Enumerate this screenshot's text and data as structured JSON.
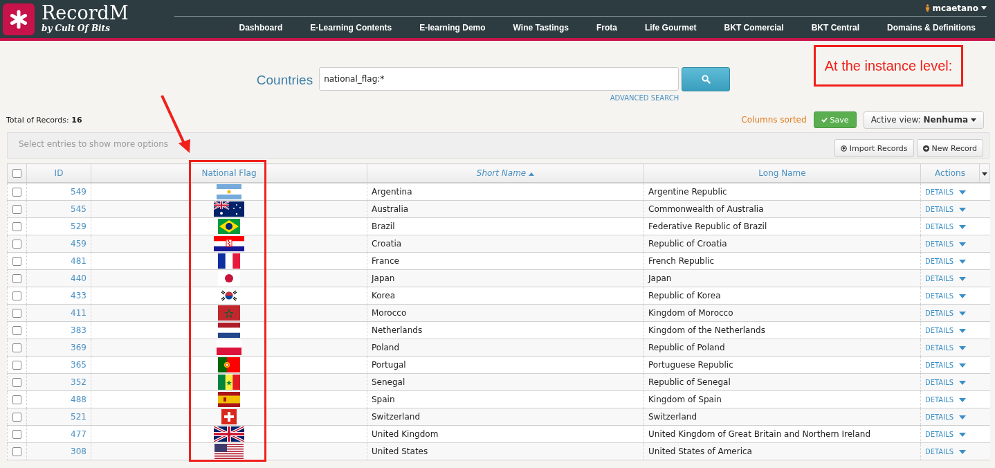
{
  "brand": {
    "name": "RecordM",
    "tagline": "by Cult Of Bits"
  },
  "user": {
    "name": "mcaetano"
  },
  "nav": [
    "Dashboard",
    "E-Learning Contents",
    "E-learning Demo",
    "Wine Tastings",
    "Frota",
    "Life Gourmet",
    "BKT Comercial",
    "BKT Central",
    "Domains & Definitions"
  ],
  "search": {
    "title": "Countries",
    "value": "national_flag:*",
    "advanced": "ADVANCED SEARCH"
  },
  "annotation": {
    "text": "At the instance level:"
  },
  "total": {
    "label": "Total of Records:",
    "count": "16"
  },
  "toolbar": {
    "status": "Columns sorted",
    "save": "Save",
    "view_label": "Active view:",
    "view_value": "Nenhuma"
  },
  "options_hint": "Select entries to show more options",
  "actions": [
    "Import Records",
    "New Record"
  ],
  "select_all": {
    "checked": false
  },
  "columns": [
    {
      "label": "ID",
      "sorted": false
    },
    {
      "label": "National Flag",
      "sorted": false
    },
    {
      "label": "Short Name",
      "sorted": true
    },
    {
      "label": "Long Name",
      "sorted": false
    },
    {
      "label": "Actions",
      "sorted": false
    }
  ],
  "rows": [
    {
      "checked": false,
      "id": "549",
      "kind": "argentina",
      "short": "Argentina",
      "long": "Argentine Republic",
      "action": "DETAILS"
    },
    {
      "checked": false,
      "id": "545",
      "kind": "australia",
      "short": "Australia",
      "long": "Commonwealth of Australia",
      "action": "DETAILS"
    },
    {
      "checked": false,
      "id": "529",
      "kind": "brazil",
      "short": "Brazil",
      "long": "Federative Republic of Brazil",
      "action": "DETAILS"
    },
    {
      "checked": false,
      "id": "459",
      "kind": "croatia",
      "short": "Croatia",
      "long": "Republic of Croatia",
      "action": "DETAILS"
    },
    {
      "checked": false,
      "id": "481",
      "kind": "france",
      "short": "France",
      "long": "French Republic",
      "action": "DETAILS"
    },
    {
      "checked": false,
      "id": "440",
      "kind": "japan",
      "short": "Japan",
      "long": "Japan",
      "action": "DETAILS"
    },
    {
      "checked": false,
      "id": "433",
      "kind": "korea",
      "short": "Korea",
      "long": "Republic of Korea",
      "action": "DETAILS"
    },
    {
      "checked": false,
      "id": "411",
      "kind": "morocco",
      "short": "Morocco",
      "long": "Kingdom of Morocco",
      "action": "DETAILS"
    },
    {
      "checked": false,
      "id": "383",
      "kind": "netherlands",
      "short": "Netherlands",
      "long": "Kingdom of the Netherlands",
      "action": "DETAILS"
    },
    {
      "checked": false,
      "id": "369",
      "kind": "poland",
      "short": "Poland",
      "long": "Republic of Poland",
      "action": "DETAILS"
    },
    {
      "checked": false,
      "id": "365",
      "kind": "portugal",
      "short": "Portugal",
      "long": "Portuguese Republic",
      "action": "DETAILS"
    },
    {
      "checked": false,
      "id": "352",
      "kind": "senegal",
      "short": "Senegal",
      "long": "Republic of Senegal",
      "action": "DETAILS"
    },
    {
      "checked": false,
      "id": "488",
      "kind": "spain",
      "short": "Spain",
      "long": "Kingdom of Spain",
      "action": "DETAILS"
    },
    {
      "checked": false,
      "id": "521",
      "kind": "switzerland",
      "short": "Switzerland",
      "long": "Switzerland",
      "action": "DETAILS"
    },
    {
      "checked": false,
      "id": "477",
      "kind": "uk",
      "short": "United Kingdom",
      "long": "United Kingdom of Great Britain and Northern Ireland",
      "action": "DETAILS"
    },
    {
      "checked": false,
      "id": "308",
      "kind": "usa",
      "short": "United States",
      "long": "United States of America",
      "action": "DETAILS"
    }
  ]
}
